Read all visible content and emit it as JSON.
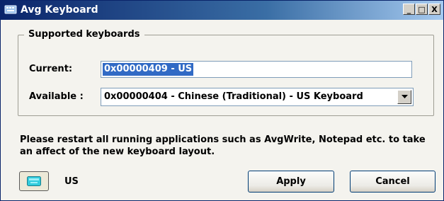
{
  "window": {
    "title": "Avg Keyboard",
    "minimize_glyph": "_",
    "maximize_glyph": "□",
    "close_glyph": "X"
  },
  "group": {
    "legend": "Supported keyboards",
    "current_label": "Current:",
    "current_value": "0x00000409 - US",
    "available_label": "Available :",
    "available_value": "0x00000404 - Chinese (Traditional) - US Keyboard"
  },
  "message": "Please restart all running applications such as AvgWrite, Notepad etc. to take an affect of the new keyboard layout.",
  "footer": {
    "language_code": "US",
    "apply_label": "Apply",
    "cancel_label": "Cancel"
  },
  "colors": {
    "titlebar_start": "#0a246a",
    "selection": "#316ac5",
    "keyboard_icon": "#33ccdd"
  }
}
